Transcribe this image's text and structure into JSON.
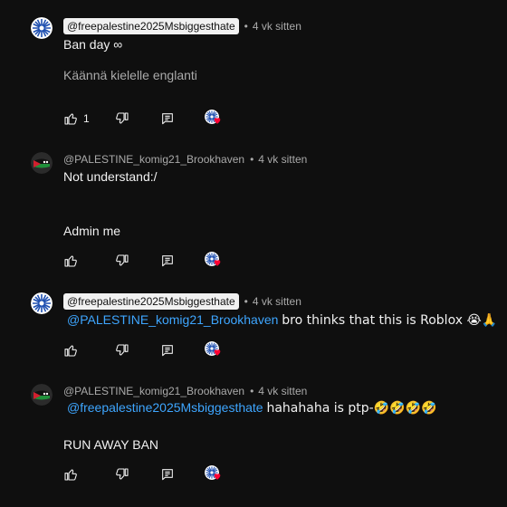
{
  "comments": [
    {
      "author": "@freepalestine2025Msbiggesthate",
      "time": "4 vk sitten",
      "text": "Ban day ∞",
      "translate": "Käännä kielelle englanti",
      "likes": "1"
    },
    {
      "author": "@PALESTINE_komig21_Brookhaven",
      "time": "4 vk sitten",
      "line1": "Not understand:/",
      "line2": "Admin me"
    },
    {
      "author": "@freepalestine2025Msbiggesthate",
      "time": "4 vk sitten",
      "mention": "@PALESTINE_komig21_Brookhaven",
      "text": "bro thinks that this is Roblox 😭🙏"
    },
    {
      "author": "@PALESTINE_komig21_Brookhaven",
      "time": "4 vk sitten",
      "mention": "@freepalestine2025Msbiggesthate",
      "text": "hahahaha is ptp-🤣🤣🤣🤣",
      "line2": "RUN AWAY BAN"
    }
  ],
  "separator": "•",
  "icons": {
    "like": "thumb-up-icon",
    "dislike": "thumb-down-icon",
    "reply": "reply-icon",
    "heart": "creator-heart-icon"
  },
  "colors": {
    "background": "#0f0f0f",
    "text": "#f1f1f1",
    "muted": "#aaaaaa",
    "mention": "#3ea6ff",
    "heart": "#ff0033"
  }
}
